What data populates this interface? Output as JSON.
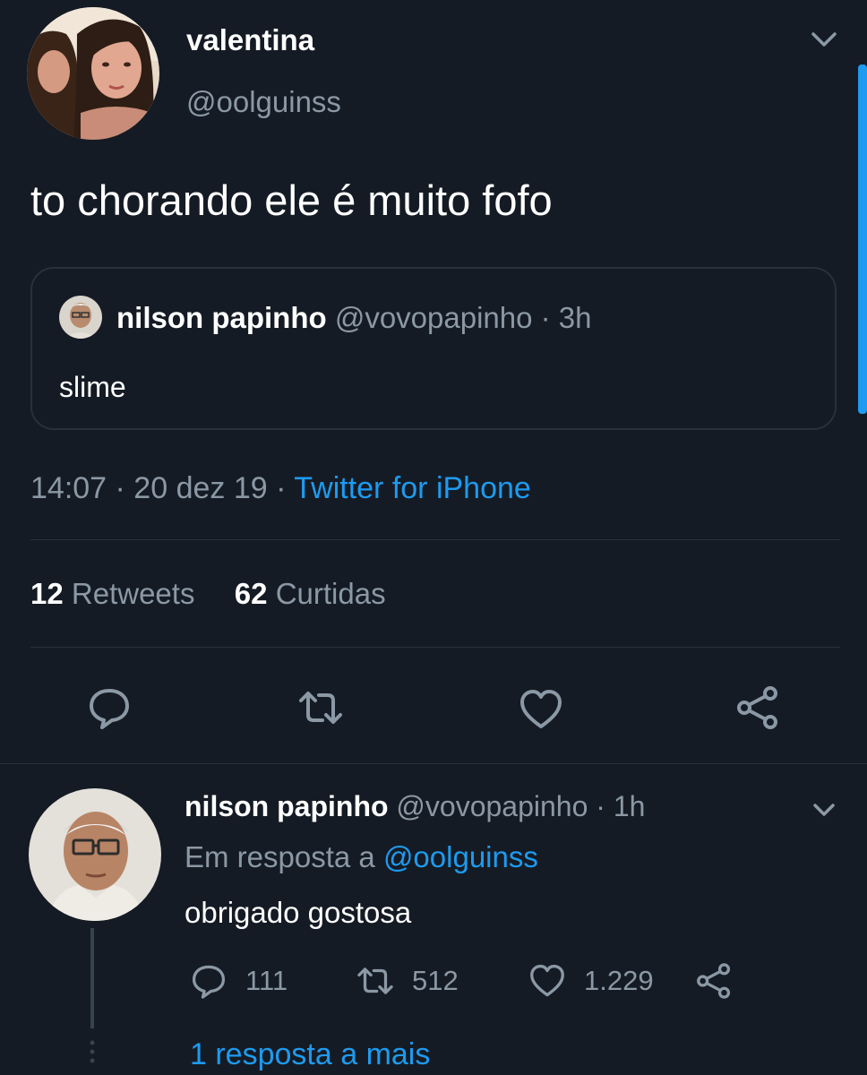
{
  "tweet": {
    "author_name": "valentina",
    "author_handle": "@oolguinss",
    "text": "to chorando ele é muito fofo",
    "quoted": {
      "author_name": "nilson papinho",
      "meta": "@vovopapinho · 3h",
      "text": "slime"
    },
    "time": "14:07 · 20 dez 19 · ",
    "source": "Twitter for iPhone",
    "stats": {
      "retweets_count": "12",
      "retweets_label": "Retweets",
      "likes_count": "62",
      "likes_label": "Curtidas"
    },
    "actions": [
      "reply-icon",
      "retweet-icon",
      "like-icon",
      "share-icon"
    ]
  },
  "reply": {
    "author_name": "nilson papinho",
    "meta": "@vovopapinho · 1h",
    "reply_prefix": "Em resposta a",
    "reply_handle": "@oolguinss",
    "text": "obrigado gostosa",
    "reply_count": "111",
    "retweet_count": "512",
    "like_count": "1.229",
    "more_replies": "1 resposta a mais"
  },
  "colors": {
    "background": "#151b24",
    "secondary_text": "#8b98a5",
    "accent": "#1d9bf0",
    "divider": "#27313c"
  }
}
